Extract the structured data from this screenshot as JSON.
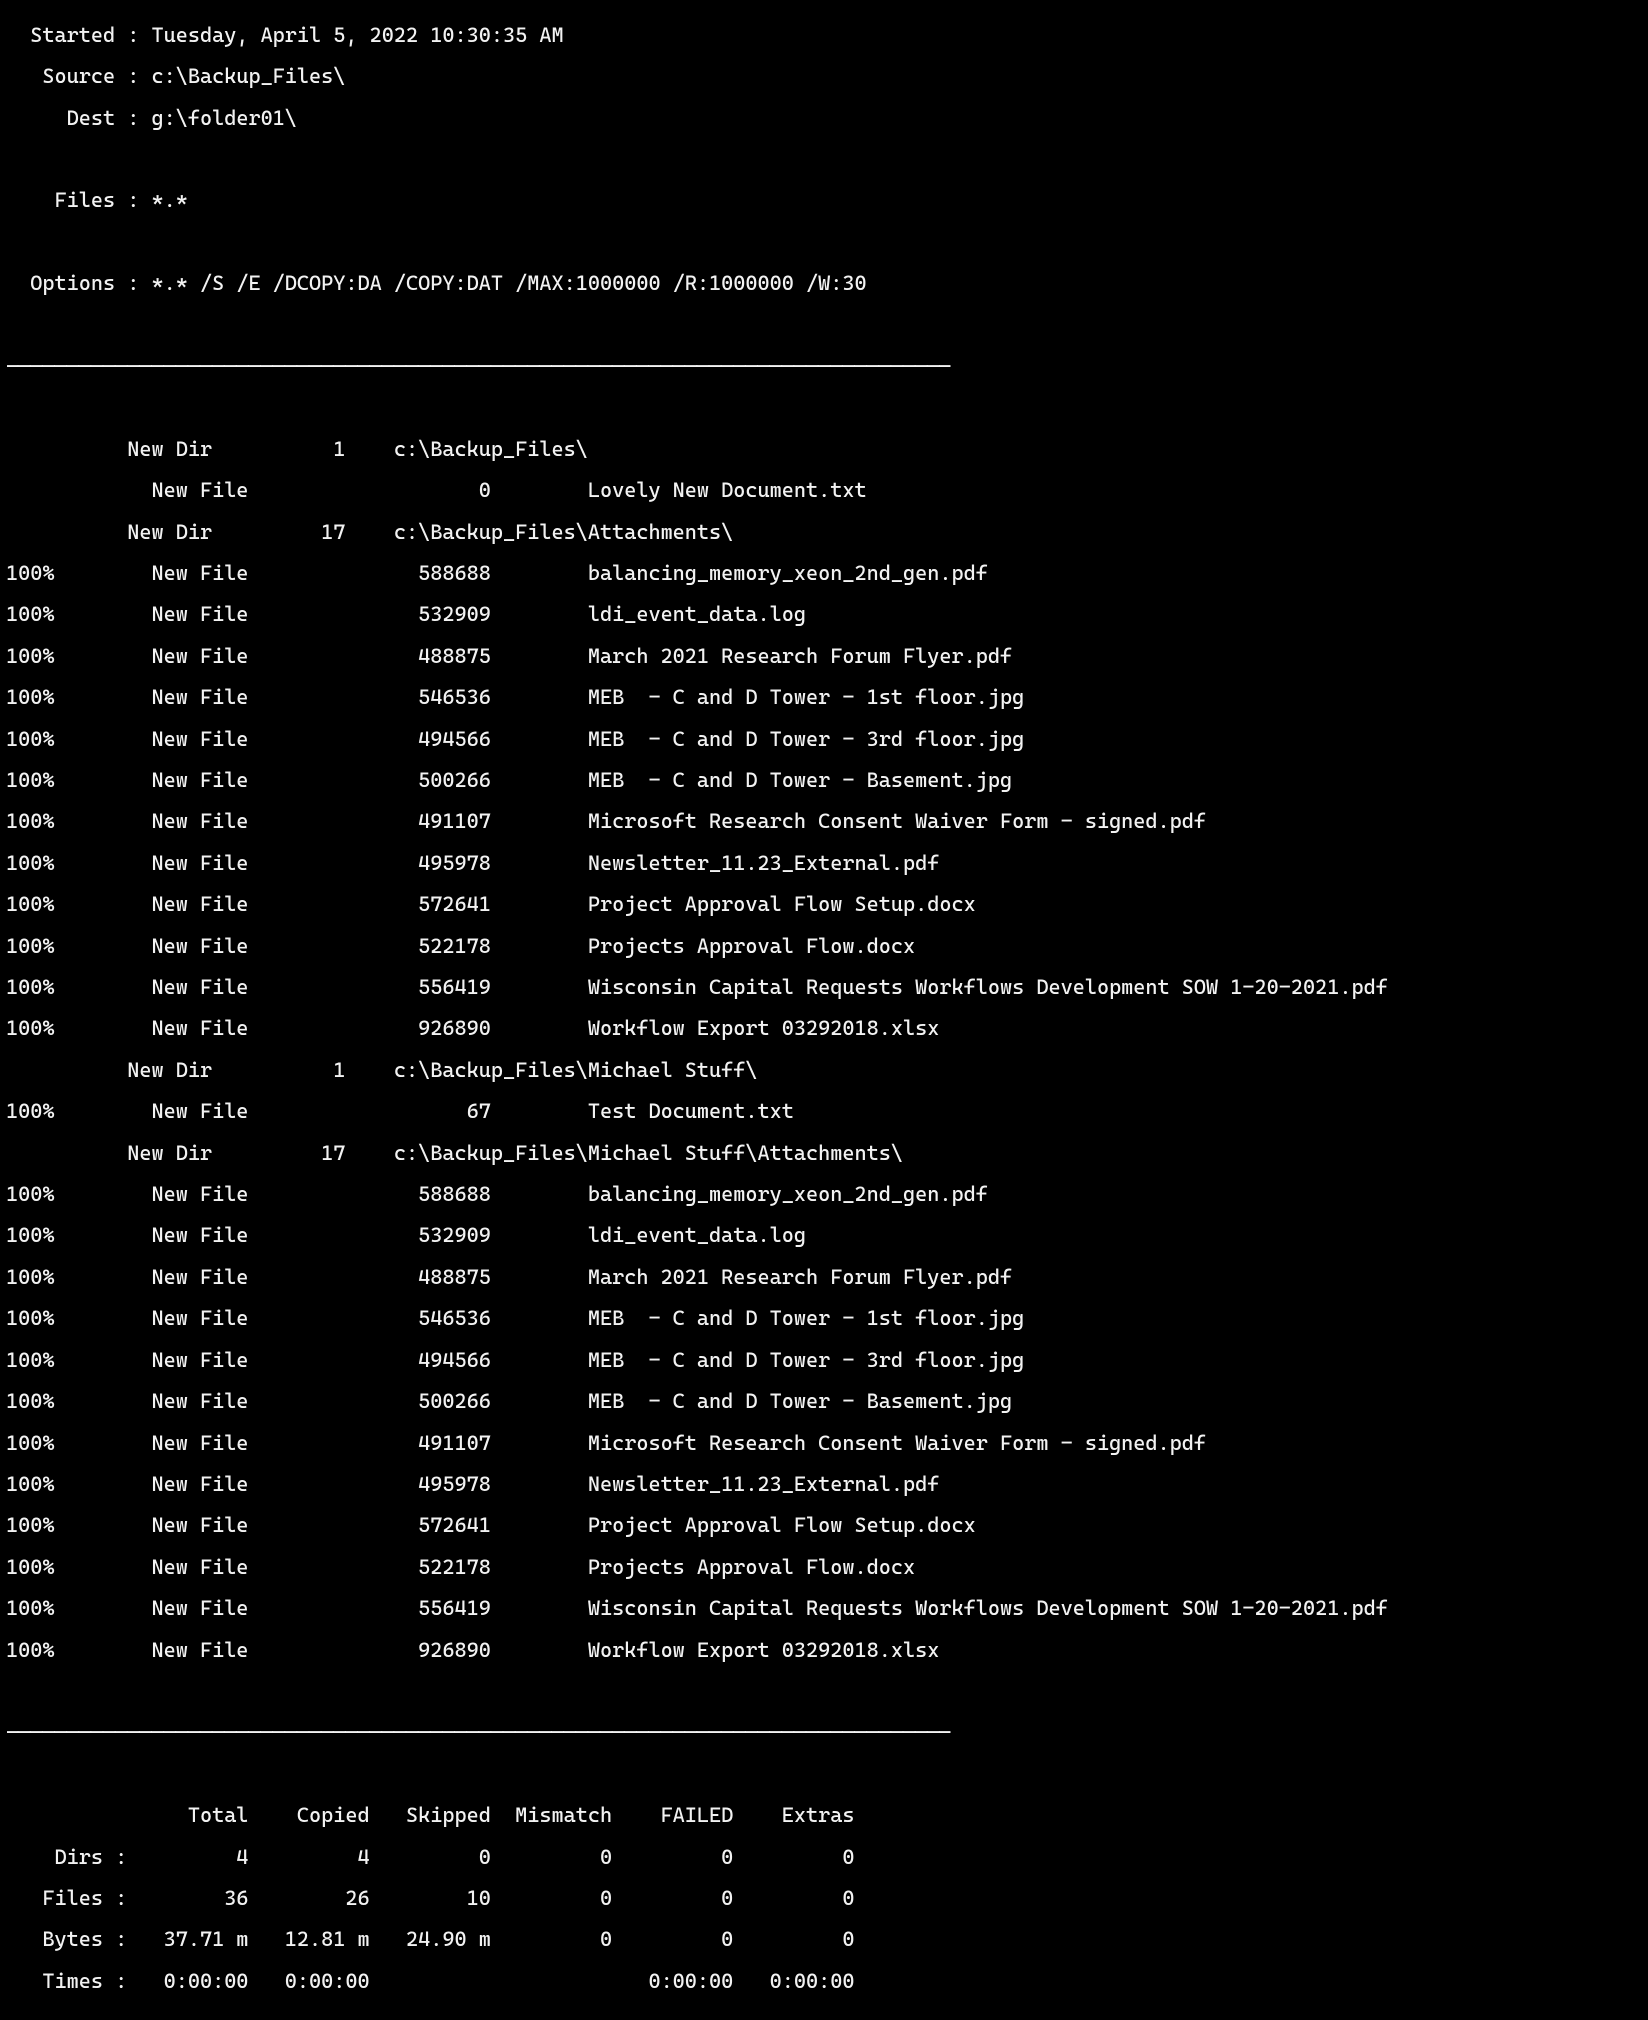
{
  "header": {
    "started_lbl": "  Started : ",
    "started_val": "Tuesday, April 5, 2022 10:30:35 AM",
    "source_lbl": "   Source : ",
    "source_val": "c:\\Backup_Files\\",
    "dest_lbl": "     Dest : ",
    "dest_val": "g:\\folder01\\",
    "files_lbl": "    Files : ",
    "files_val": "*.*",
    "options_lbl": "  Options : ",
    "options_val": "*.* /S /E /DCOPY:DA /COPY:DAT /MAX:1000000 /R:1000000 /W:30"
  },
  "separator": "------------------------------------------------------------------------------",
  "log_lines": [
    "          New Dir          1    c:\\Backup_Files\\",
    "            New File                   0        Lovely New Document.txt",
    "          New Dir         17    c:\\Backup_Files\\Attachments\\",
    "100%        New File              588688        balancing_memory_xeon_2nd_gen.pdf",
    "100%        New File              532909        ldi_event_data.log",
    "100%        New File              488875        March 2021 Research Forum Flyer.pdf",
    "100%        New File              546536        MEB  - C and D Tower - 1st floor.jpg",
    "100%        New File              494566        MEB  - C and D Tower - 3rd floor.jpg",
    "100%        New File              500266        MEB  - C and D Tower - Basement.jpg",
    "100%        New File              491107        Microsoft Research Consent Waiver Form - signed.pdf",
    "100%        New File              495978        Newsletter_11.23_External.pdf",
    "100%        New File              572641        Project Approval Flow Setup.docx",
    "100%        New File              522178        Projects Approval Flow.docx",
    "100%        New File              556419        Wisconsin Capital Requests Workflows Development SOW 1-20-2021.pdf",
    "100%        New File              926890        Workflow Export 03292018.xlsx",
    "          New Dir          1    c:\\Backup_Files\\Michael Stuff\\",
    "100%        New File                  67        Test Document.txt",
    "          New Dir         17    c:\\Backup_Files\\Michael Stuff\\Attachments\\",
    "100%        New File              588688        balancing_memory_xeon_2nd_gen.pdf",
    "100%        New File              532909        ldi_event_data.log",
    "100%        New File              488875        March 2021 Research Forum Flyer.pdf",
    "100%        New File              546536        MEB  - C and D Tower - 1st floor.jpg",
    "100%        New File              494566        MEB  - C and D Tower - 3rd floor.jpg",
    "100%        New File              500266        MEB  - C and D Tower - Basement.jpg",
    "100%        New File              491107        Microsoft Research Consent Waiver Form - signed.pdf",
    "100%        New File              495978        Newsletter_11.23_External.pdf",
    "100%        New File              572641        Project Approval Flow Setup.docx",
    "100%        New File              522178        Projects Approval Flow.docx",
    "100%        New File              556419        Wisconsin Capital Requests Workflows Development SOW 1-20-2021.pdf",
    "100%        New File              926890        Workflow Export 03292018.xlsx"
  ],
  "summary": {
    "header": "               Total    Copied   Skipped  Mismatch    FAILED    Extras",
    "dirs": "    Dirs :         4         4         0         0         0         0",
    "files": "   Files :        36        26        10         0         0         0",
    "bytes": "   Bytes :   37.71 m   12.81 m   24.90 m         0         0         0",
    "times": "   Times :   0:00:00   0:00:00                       0:00:00   0:00:00"
  }
}
